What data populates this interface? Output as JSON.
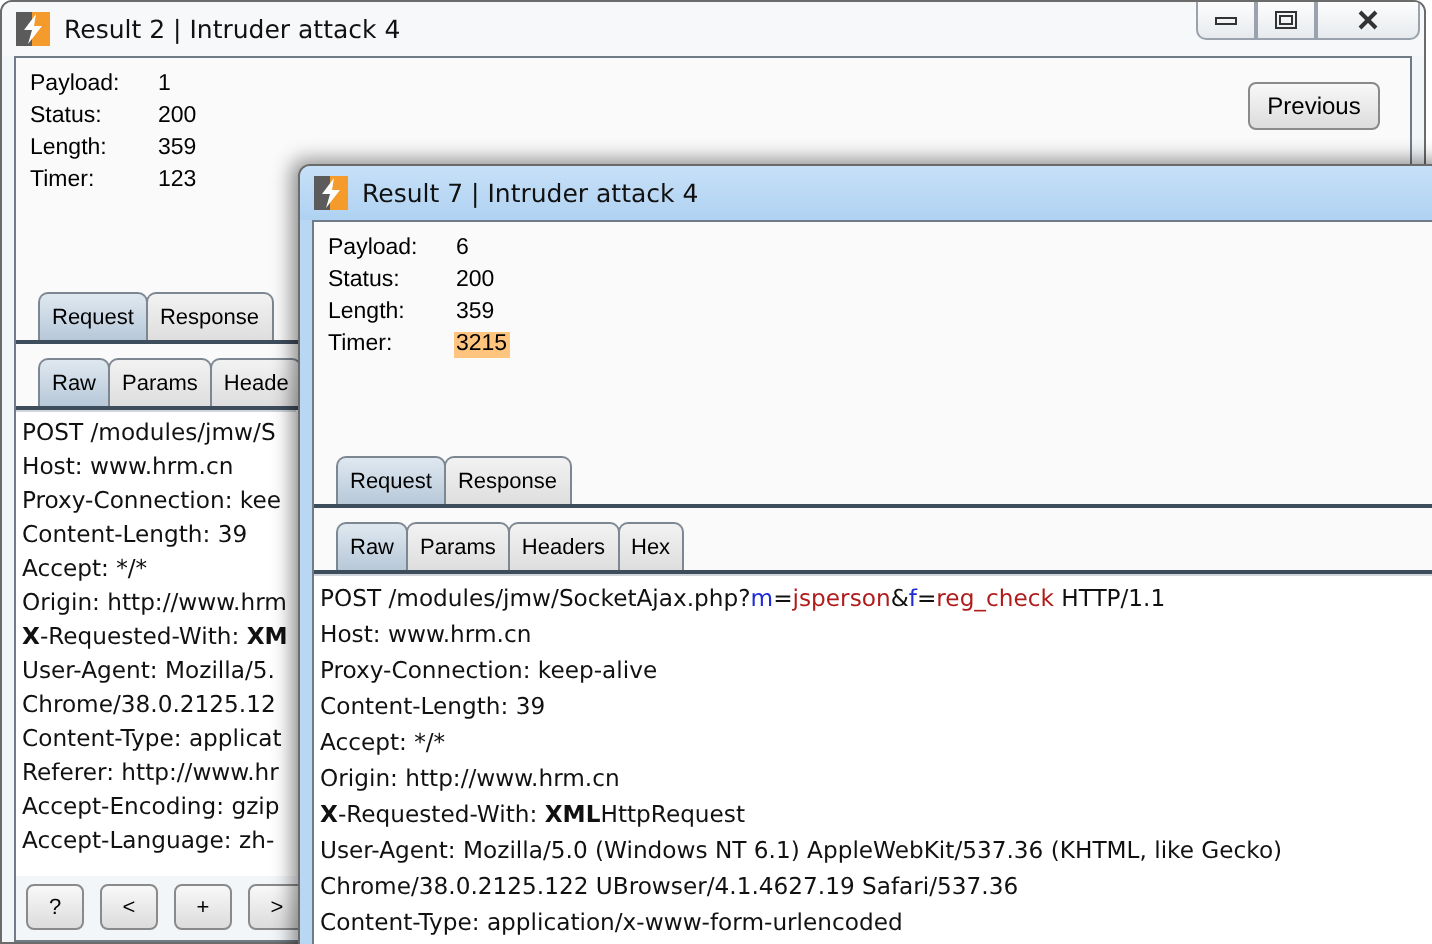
{
  "windows": [
    {
      "title": "Result 2 | Intruder attack 4",
      "active": false,
      "window_controls": true,
      "fields": [
        {
          "label": "Payload:",
          "value": "1",
          "highlighted": false
        },
        {
          "label": "Status:",
          "value": "200",
          "highlighted": false
        },
        {
          "label": "Length:",
          "value": "359",
          "highlighted": false
        },
        {
          "label": "Timer:",
          "value": "123",
          "highlighted": false
        }
      ],
      "nav_buttons": [
        {
          "label": "Previous"
        }
      ],
      "tabs": [
        {
          "label": "Request",
          "selected": true
        },
        {
          "label": "Response",
          "selected": false
        }
      ],
      "subtabs": [
        {
          "label": "Raw",
          "selected": true
        },
        {
          "label": "Params",
          "selected": false
        },
        {
          "label": "Heade",
          "selected": false
        }
      ],
      "lines": [
        {
          "text": "POST /modules/jmw/S"
        },
        {
          "text": "Host: www.hrm.cn"
        },
        {
          "text": "Proxy-Connection: kee"
        },
        {
          "text": "Content-Length: 39"
        },
        {
          "text": "Accept: */*"
        },
        {
          "text": "Origin: http://www.hrm"
        },
        {
          "segments": [
            {
              "text": "X",
              "kind": "bold"
            },
            {
              "text": "-Requested-With: ",
              "kind": "plain"
            },
            {
              "text": "XM",
              "kind": "bold"
            }
          ]
        },
        {
          "text": "User-Agent: Mozilla/5."
        },
        {
          "text": "Chrome/38.0.2125.12"
        },
        {
          "text": "Content-Type: applicat"
        },
        {
          "text": "Referer: http://www.hr"
        },
        {
          "text": "Accept-Encoding: gzip"
        },
        {
          "text": "Accept-Language: zh-"
        }
      ],
      "bottom_buttons": [
        "?",
        "<",
        "+",
        ">"
      ]
    },
    {
      "title": "Result 7 | Intruder attack 4",
      "active": true,
      "fields": [
        {
          "label": "Payload:",
          "value": "6",
          "highlighted": false
        },
        {
          "label": "Status:",
          "value": "200",
          "highlighted": false
        },
        {
          "label": "Length:",
          "value": "359",
          "highlighted": false
        },
        {
          "label": "Timer:",
          "value": "3215",
          "highlighted": true
        }
      ],
      "tabs": [
        {
          "label": "Request",
          "selected": true
        },
        {
          "label": "Response",
          "selected": false
        }
      ],
      "subtabs": [
        {
          "label": "Raw",
          "selected": true
        },
        {
          "label": "Params",
          "selected": false
        },
        {
          "label": "Headers",
          "selected": false
        },
        {
          "label": "Hex",
          "selected": false
        }
      ],
      "lines": [
        {
          "segments": [
            {
              "text": "POST /modules/jmw/SocketAjax.php?",
              "kind": "plain"
            },
            {
              "text": "m",
              "kind": "name"
            },
            {
              "text": "=",
              "kind": "plain"
            },
            {
              "text": "jsperson",
              "kind": "value"
            },
            {
              "text": "&",
              "kind": "plain"
            },
            {
              "text": "f",
              "kind": "name"
            },
            {
              "text": "=",
              "kind": "plain"
            },
            {
              "text": "reg_check",
              "kind": "value"
            },
            {
              "text": " HTTP/1.1",
              "kind": "plain"
            }
          ]
        },
        {
          "text": "Host: www.hrm.cn"
        },
        {
          "text": "Proxy-Connection: keep-alive"
        },
        {
          "text": "Content-Length: 39"
        },
        {
          "text": "Accept: */*"
        },
        {
          "text": "Origin: http://www.hrm.cn"
        },
        {
          "segments": [
            {
              "text": "X",
              "kind": "bold"
            },
            {
              "text": "-Requested-With: ",
              "kind": "plain"
            },
            {
              "text": "XML",
              "kind": "bold"
            },
            {
              "text": "HttpRequest",
              "kind": "plain"
            }
          ]
        },
        {
          "text": "User-Agent: Mozilla/5.0 (Windows NT 6.1) AppleWebKit/537.36 (KHTML, like Gecko)"
        },
        {
          "text": "Chrome/38.0.2125.122 UBrowser/4.1.4627.19 Safari/537.36"
        },
        {
          "text": "Content-Type: application/x-www-form-urlencoded"
        }
      ]
    }
  ]
}
